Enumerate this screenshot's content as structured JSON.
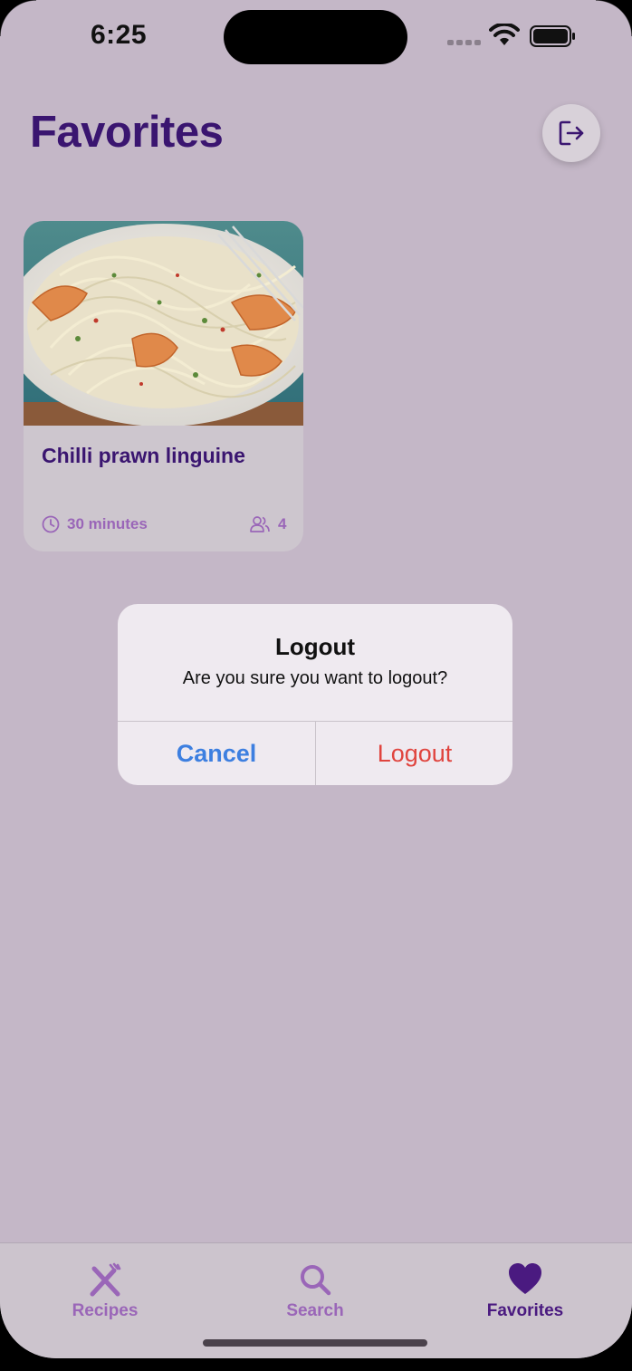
{
  "status_bar": {
    "time": "6:25"
  },
  "header": {
    "title": "Favorites",
    "logout_icon": "logout-arrow-icon"
  },
  "favorites": [
    {
      "title": "Chilli prawn linguine",
      "duration": "30 minutes",
      "servings": "4"
    }
  ],
  "alert": {
    "title": "Logout",
    "message": "Are you sure you want to logout?",
    "cancel_label": "Cancel",
    "confirm_label": "Logout"
  },
  "tabbar": {
    "tabs": [
      {
        "label": "Recipes",
        "icon": "fork-knife-icon",
        "active": false
      },
      {
        "label": "Search",
        "icon": "search-icon",
        "active": false
      },
      {
        "label": "Favorites",
        "icon": "heart-icon",
        "active": true
      }
    ]
  },
  "colors": {
    "background": "#c4b7c7",
    "title": "#3a1570",
    "accent": "#9a66b8",
    "alert_cancel": "#3d7fe0",
    "alert_destructive": "#e0443e"
  }
}
